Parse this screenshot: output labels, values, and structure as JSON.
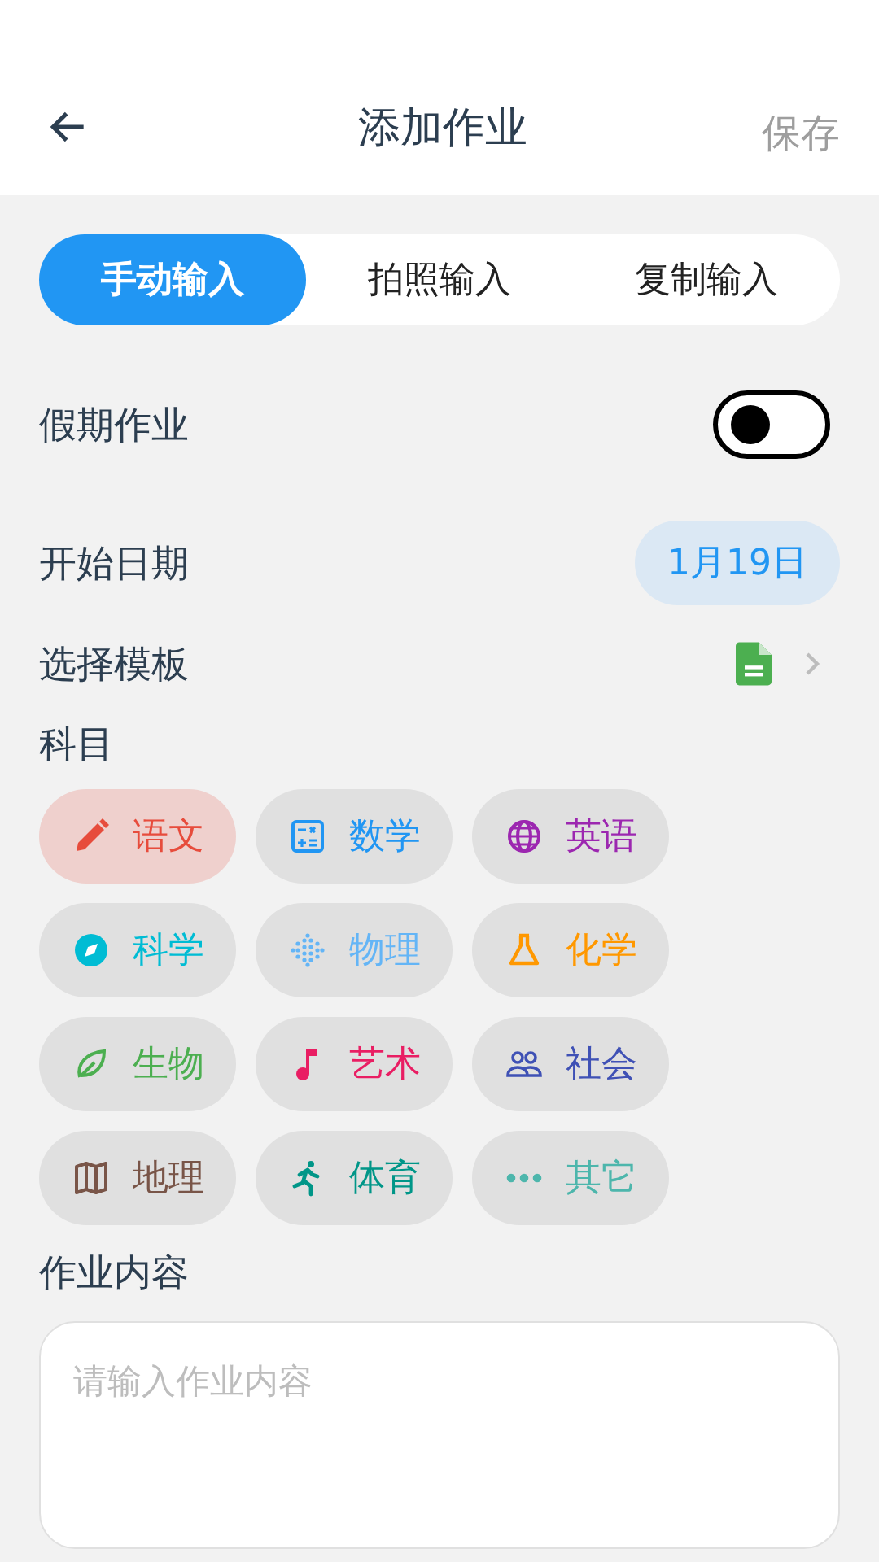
{
  "header": {
    "title": "添加作业",
    "action": "保存"
  },
  "input_tabs": [
    {
      "label": "手动输入",
      "selected": true
    },
    {
      "label": "拍照输入",
      "selected": false
    },
    {
      "label": "复制输入",
      "selected": false
    }
  ],
  "holiday": {
    "label": "假期作业",
    "on": false
  },
  "start_date": {
    "label": "开始日期",
    "value": "1月19日"
  },
  "template": {
    "label": "选择模板"
  },
  "subjects": {
    "label": "科目",
    "items": [
      {
        "label": "语文",
        "color": "#e74c3c",
        "selected": true
      },
      {
        "label": "数学",
        "color": "#2196f3",
        "selected": false
      },
      {
        "label": "英语",
        "color": "#9c27b0",
        "selected": false
      },
      {
        "label": "科学",
        "color": "#00bcd4",
        "selected": false
      },
      {
        "label": "物理",
        "color": "#64b5f6",
        "selected": false
      },
      {
        "label": "化学",
        "color": "#ff9800",
        "selected": false
      },
      {
        "label": "生物",
        "color": "#4caf50",
        "selected": false
      },
      {
        "label": "艺术",
        "color": "#e91e63",
        "selected": false
      },
      {
        "label": "社会",
        "color": "#3f51b5",
        "selected": false
      },
      {
        "label": "地理",
        "color": "#795548",
        "selected": false
      },
      {
        "label": "体育",
        "color": "#009688",
        "selected": false
      },
      {
        "label": "其它",
        "color": "#4db6ac",
        "selected": false
      }
    ]
  },
  "content": {
    "label": "作业内容",
    "placeholder": "请输入作业内容"
  }
}
